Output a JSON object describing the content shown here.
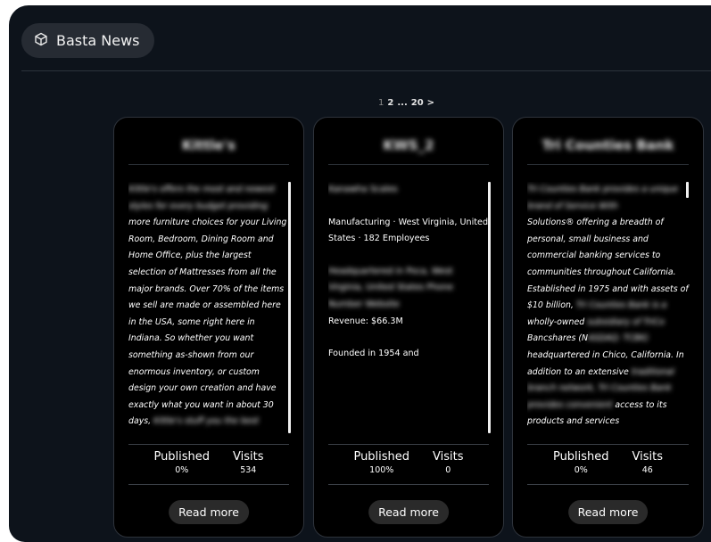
{
  "app": {
    "title": "Basta News",
    "logo_icon": "cube-icon"
  },
  "pagination": {
    "current": "1",
    "next": "2",
    "ellipsis": "...",
    "last": "20",
    "next_arrow": ">"
  },
  "cards": [
    {
      "title": "Kittle's",
      "body_blurred": "Kittle's offers the most and newest styles for every budget providing",
      "body": "more furniture choices for your Living Room, Bedroom, Dining Room and Home Office, plus the largest selection of Mattresses from all the major brands. Over 70% of the items we sell are made or assembled here in the USA, some right here in Indiana. So whether you want something as-shown from our enormous inventory, or custom design your own creation and have exactly what you want in about 30 days,",
      "body_tail_blurred": "Kittle's stuff you the best",
      "published_label": "Published",
      "published_value": "0%",
      "visits_label": "Visits",
      "visits_value": "534",
      "read_more": "Read more"
    },
    {
      "title": "KWS_2",
      "body_blurred_top": "Kanawha Scales",
      "body_industry": "Manufacturing · West Virginia, United States · 182 Employees",
      "body_blurred_mid": "Headquartered in Poca, West Virginia, United States Phone Number Website",
      "body_revenue": "Revenue: $66.3M",
      "body_founded": "Founded in 1954 and",
      "published_label": "Published",
      "published_value": "100%",
      "visits_label": "Visits",
      "visits_value": "0",
      "read_more": "Read more"
    },
    {
      "title": "Tri Counties Bank",
      "body_blurred": "Tri Counties Bank provides a unique brand of Service With",
      "body": "Solutions® offering a breadth of personal, small business and commercial banking services to communities throughout California. Established in 1975 and with assets of $10 billion,",
      "body_inline_blur_1": "Tri Counties Bank is a",
      "body_2": "wholly-owned",
      "body_inline_blur_2": "subsidiary of TriCo",
      "body_3": "Bancshares (N",
      "body_inline_blur_3": "ASDAQ: TCBK)",
      "body_4": "headquartered in Chico, California. In addition to an extensive",
      "body_blurred_tail": "traditional branch network, Tri Counties Bank provides convenient",
      "body_5": "access to its products and services",
      "published_label": "Published",
      "published_value": "0%",
      "visits_label": "Visits",
      "visits_value": "46",
      "read_more": "Read more"
    }
  ]
}
